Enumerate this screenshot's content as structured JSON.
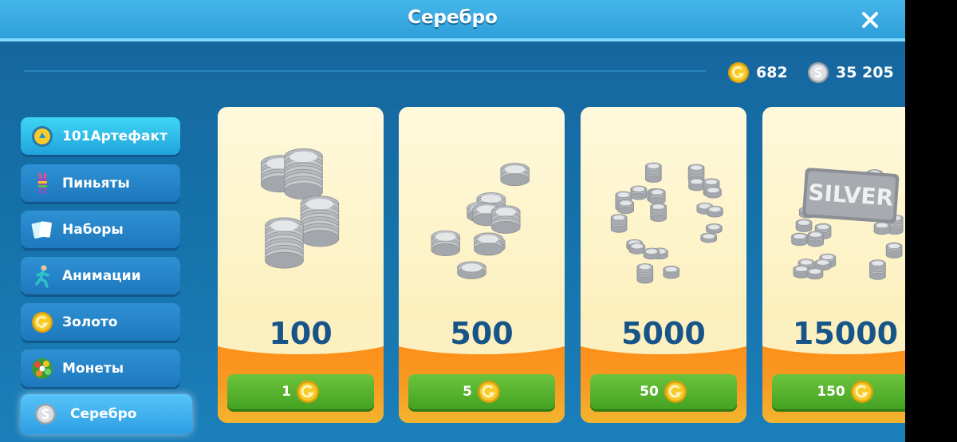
{
  "window": {
    "title": "Серебро"
  },
  "currency": {
    "gold": "682",
    "silver": "35 205"
  },
  "sidebar": {
    "items": [
      {
        "label": "101Артефакт",
        "icon": "artifact-coin-icon"
      },
      {
        "label": "Пиньяты",
        "icon": "pinata-icon"
      },
      {
        "label": "Наборы",
        "icon": "cards-icon"
      },
      {
        "label": "Анимации",
        "icon": "runner-icon"
      },
      {
        "label": "Золото",
        "icon": "gold-coin-icon"
      },
      {
        "label": "Монеты",
        "icon": "coin-wreath-icon"
      },
      {
        "label": "Серебро",
        "icon": "silver-coin-icon"
      }
    ]
  },
  "offers": [
    {
      "amount": "100",
      "price": "1"
    },
    {
      "amount": "500",
      "price": "5"
    },
    {
      "amount": "5000",
      "price": "50"
    },
    {
      "amount": "15000",
      "price": "150",
      "badge": "SILVER"
    }
  ],
  "colors": {
    "gold": "#f3c21b",
    "silver": "#c9ccd0",
    "accent": "#2f9fda",
    "buy": "#4fae2a"
  }
}
